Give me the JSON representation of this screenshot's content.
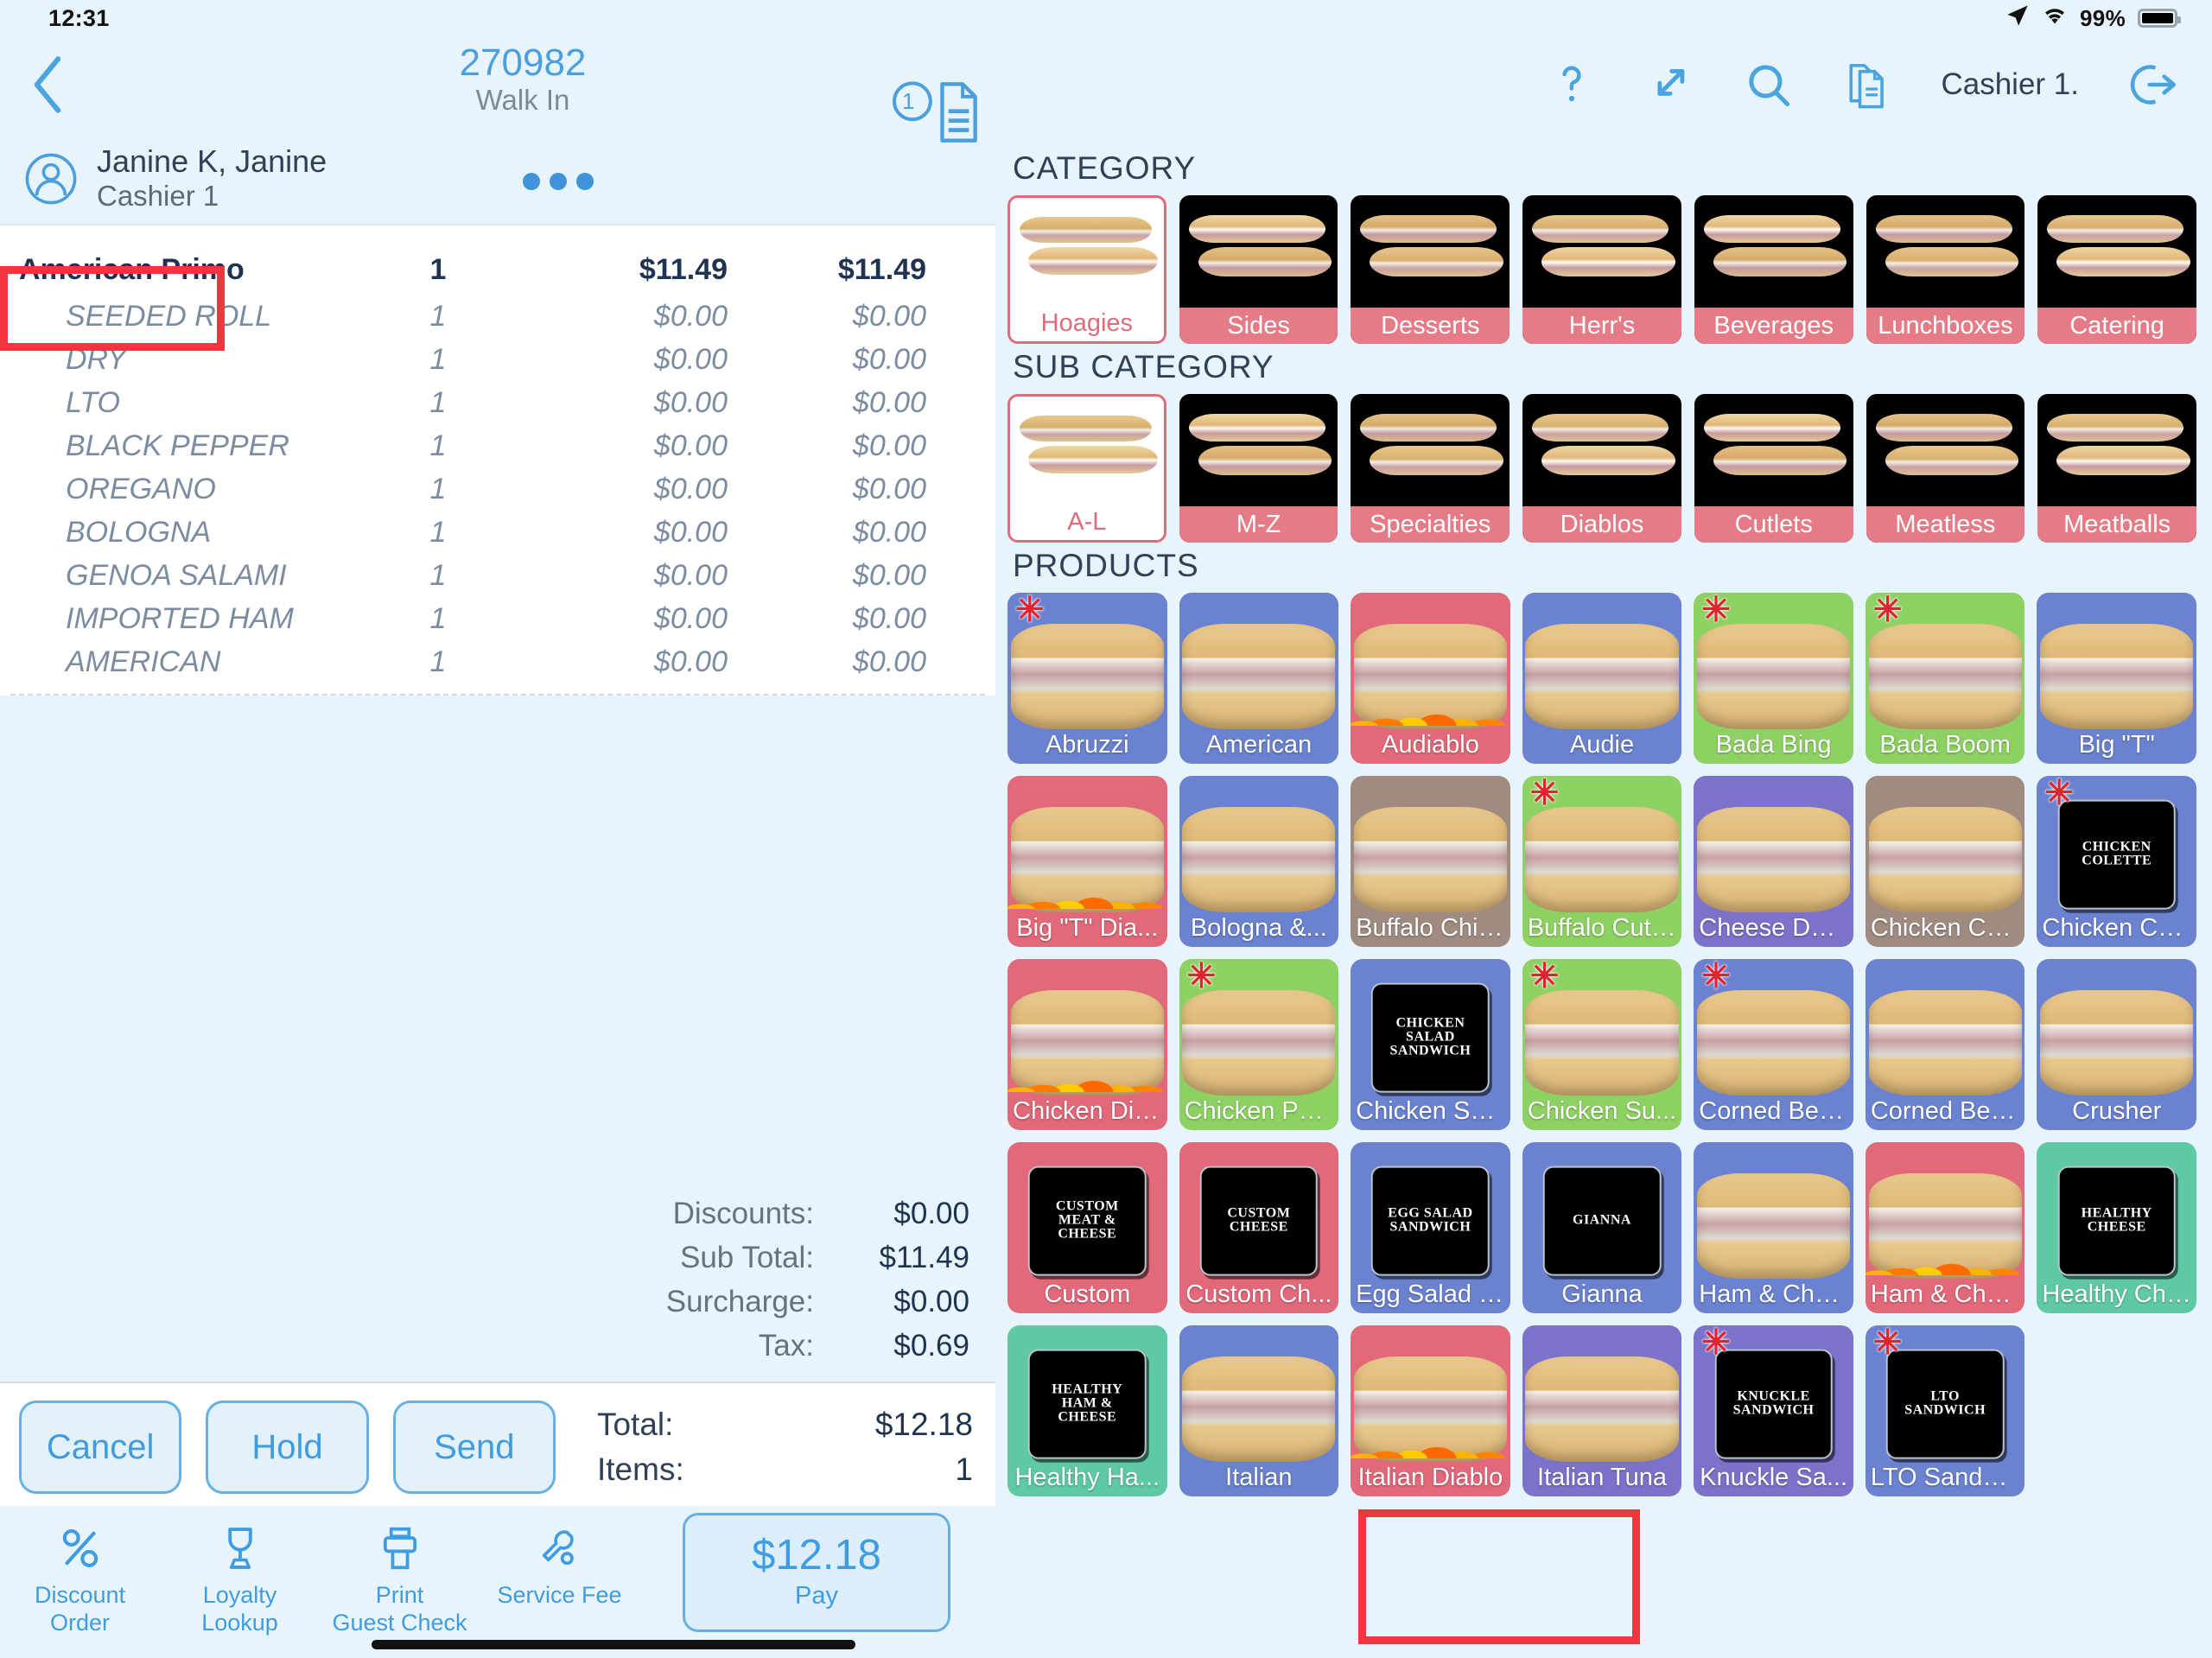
{
  "statusbar": {
    "clock": "12:31",
    "battery_pct": "99%"
  },
  "header": {
    "order_number": "270982",
    "order_type": "Walk In",
    "doc_count": "1",
    "cashier": "Cashier 1.",
    "icons": [
      "help-icon",
      "expand-icon",
      "search-icon",
      "documents-icon",
      "logout-icon"
    ]
  },
  "customer": {
    "name": "Janine K, Janine",
    "role": "Cashier 1"
  },
  "order": {
    "items": [
      {
        "name": "American Primo",
        "qty": "1",
        "unit": "$11.49",
        "total": "$11.49",
        "modifier": false
      },
      {
        "name": "SEEDED ROLL",
        "qty": "1",
        "unit": "$0.00",
        "total": "$0.00",
        "modifier": true
      },
      {
        "name": "DRY",
        "qty": "1",
        "unit": "$0.00",
        "total": "$0.00",
        "modifier": true
      },
      {
        "name": "LTO",
        "qty": "1",
        "unit": "$0.00",
        "total": "$0.00",
        "modifier": true
      },
      {
        "name": "BLACK PEPPER",
        "qty": "1",
        "unit": "$0.00",
        "total": "$0.00",
        "modifier": true
      },
      {
        "name": "OREGANO",
        "qty": "1",
        "unit": "$0.00",
        "total": "$0.00",
        "modifier": true
      },
      {
        "name": "BOLOGNA",
        "qty": "1",
        "unit": "$0.00",
        "total": "$0.00",
        "modifier": true
      },
      {
        "name": "GENOA SALAMI",
        "qty": "1",
        "unit": "$0.00",
        "total": "$0.00",
        "modifier": true
      },
      {
        "name": "IMPORTED HAM",
        "qty": "1",
        "unit": "$0.00",
        "total": "$0.00",
        "modifier": true
      },
      {
        "name": "AMERICAN",
        "qty": "1",
        "unit": "$0.00",
        "total": "$0.00",
        "modifier": true
      }
    ],
    "summary": [
      {
        "label": "Discounts:",
        "value": "$0.00"
      },
      {
        "label": "Sub Total:",
        "value": "$11.49"
      },
      {
        "label": "Surcharge:",
        "value": "$0.00"
      },
      {
        "label": "Tax:",
        "value": "$0.69"
      }
    ],
    "total_label": "Total:",
    "total_value": "$12.18",
    "items_label": "Items:",
    "items_value": "1"
  },
  "actions": {
    "cancel": "Cancel",
    "hold": "Hold",
    "send": "Send"
  },
  "footer": {
    "buttons": [
      {
        "label": "Discount\nOrder",
        "line1": "Discount",
        "line2": "Order",
        "icon": "percent-icon"
      },
      {
        "label": "Loyalty\nLookup",
        "line1": "Loyalty",
        "line2": "Lookup",
        "icon": "trophy-icon"
      },
      {
        "label": "Print\nGuest Check",
        "line1": "Print",
        "line2": "Guest Check",
        "icon": "printer-icon"
      },
      {
        "label": "Service Fee",
        "line1": "Service Fee",
        "line2": "",
        "icon": "wrench-icon"
      }
    ],
    "pay_amount": "$12.18",
    "pay_label": "Pay"
  },
  "menu": {
    "category_title": "CATEGORY",
    "subcategory_title": "SUB CATEGORY",
    "products_title": "PRODUCTS",
    "categories": [
      {
        "label": "Hoagies",
        "selected": true
      },
      {
        "label": "Sides",
        "selected": false
      },
      {
        "label": "Desserts",
        "selected": false
      },
      {
        "label": "Herr's",
        "selected": false
      },
      {
        "label": "Beverages",
        "selected": false
      },
      {
        "label": "Lunchboxes",
        "selected": false
      },
      {
        "label": "Catering",
        "selected": false
      }
    ],
    "subcategories": [
      {
        "label": "A-L",
        "selected": true
      },
      {
        "label": "M-Z",
        "selected": false
      },
      {
        "label": "Specialties",
        "selected": false
      },
      {
        "label": "Diablos",
        "selected": false
      },
      {
        "label": "Cutlets",
        "selected": false
      },
      {
        "label": "Meatless",
        "selected": false
      },
      {
        "label": "Meatballs",
        "selected": false
      }
    ],
    "products": [
      {
        "label": "Abruzzi",
        "color": "#6a82d0",
        "star": true,
        "kind": "photo"
      },
      {
        "label": "American",
        "color": "#6a82d0",
        "star": false,
        "kind": "photo"
      },
      {
        "label": "Audiablo",
        "color": "#e2697a",
        "star": false,
        "kind": "photo",
        "flames": true
      },
      {
        "label": "Audie",
        "color": "#6a82d0",
        "star": false,
        "kind": "photo"
      },
      {
        "label": "Bada Bing",
        "color": "#8ed163",
        "star": true,
        "kind": "photo"
      },
      {
        "label": "Bada Boom",
        "color": "#8ed163",
        "star": true,
        "kind": "photo"
      },
      {
        "label": "Big \"T\"",
        "color": "#6a82d0",
        "star": false,
        "kind": "photo"
      },
      {
        "label": "Big \"T\" Dia...",
        "color": "#e2697a",
        "star": false,
        "kind": "photo",
        "flames": true
      },
      {
        "label": "Bologna &...",
        "color": "#6a82d0",
        "star": false,
        "kind": "photo"
      },
      {
        "label": "Buffalo Chic...",
        "color": "#a08b81",
        "star": false,
        "kind": "photo"
      },
      {
        "label": "Buffalo Cutlet",
        "color": "#8ed163",
        "star": true,
        "kind": "photo"
      },
      {
        "label": "Cheese Del...",
        "color": "#7b72c9",
        "star": false,
        "kind": "photo"
      },
      {
        "label": "Chicken Ch...",
        "color": "#a08b81",
        "star": false,
        "kind": "photo"
      },
      {
        "label": "Chicken Col...",
        "color": "#6a82d0",
        "star": true,
        "kind": "placard",
        "placard": [
          "CHICKEN",
          "COLETTE"
        ]
      },
      {
        "label": "Chicken Dia...",
        "color": "#e2697a",
        "star": false,
        "kind": "photo",
        "flames": true
      },
      {
        "label": "Chicken Par...",
        "color": "#8ed163",
        "star": true,
        "kind": "photo"
      },
      {
        "label": "Chicken Sal...",
        "color": "#6a82d0",
        "star": false,
        "kind": "placard",
        "placard": [
          "CHICKEN",
          "SALAD",
          "SANDWICH"
        ]
      },
      {
        "label": "Chicken Su...",
        "color": "#8ed163",
        "star": true,
        "kind": "photo"
      },
      {
        "label": "Corned Bee...",
        "color": "#6a82d0",
        "star": true,
        "kind": "photo"
      },
      {
        "label": "Corned Bee...",
        "color": "#6a82d0",
        "star": false,
        "kind": "photo"
      },
      {
        "label": "Crusher",
        "color": "#6a82d0",
        "star": false,
        "kind": "photo"
      },
      {
        "label": "Custom",
        "color": "#e2697a",
        "star": false,
        "kind": "placard",
        "placard": [
          "CUSTOM",
          "MEAT &",
          "CHEESE"
        ]
      },
      {
        "label": "Custom Ch...",
        "color": "#e2697a",
        "star": false,
        "kind": "placard",
        "placard": [
          "CUSTOM",
          "CHEESE"
        ]
      },
      {
        "label": "Egg Salad S...",
        "color": "#6a82d0",
        "star": false,
        "kind": "placard",
        "placard": [
          "EGG SALAD",
          "SANDWICH"
        ]
      },
      {
        "label": "Gianna",
        "color": "#6a82d0",
        "star": false,
        "kind": "placard",
        "placard": [
          "GIANNA"
        ]
      },
      {
        "label": "Ham & Che...",
        "color": "#6a82d0",
        "star": false,
        "kind": "photo"
      },
      {
        "label": "Ham & Che...",
        "color": "#e2697a",
        "star": false,
        "kind": "photo",
        "flames": true
      },
      {
        "label": "Healthy Che...",
        "color": "#5fc9a4",
        "star": false,
        "kind": "placard",
        "placard": [
          "HEALTHY",
          "CHEESE"
        ]
      },
      {
        "label": "Healthy Ha...",
        "color": "#5fc9a4",
        "star": false,
        "kind": "placard",
        "placard": [
          "HEALTHY",
          "HAM &",
          "CHEESE"
        ]
      },
      {
        "label": "Italian",
        "color": "#6a82d0",
        "star": false,
        "kind": "photo"
      },
      {
        "label": "Italian Diablo",
        "color": "#e2697a",
        "star": false,
        "kind": "photo",
        "flames": true
      },
      {
        "label": "Italian Tuna",
        "color": "#7b72c9",
        "star": false,
        "kind": "photo"
      },
      {
        "label": "Knuckle Sa...",
        "color": "#7b72c9",
        "star": true,
        "kind": "placard",
        "placard": [
          "KNUCKLE",
          "SANDWICH"
        ]
      },
      {
        "label": "LTO Sandwi...",
        "color": "#6a82d0",
        "star": true,
        "kind": "placard",
        "placard": [
          "LTO",
          "SANDWICH"
        ]
      }
    ]
  }
}
